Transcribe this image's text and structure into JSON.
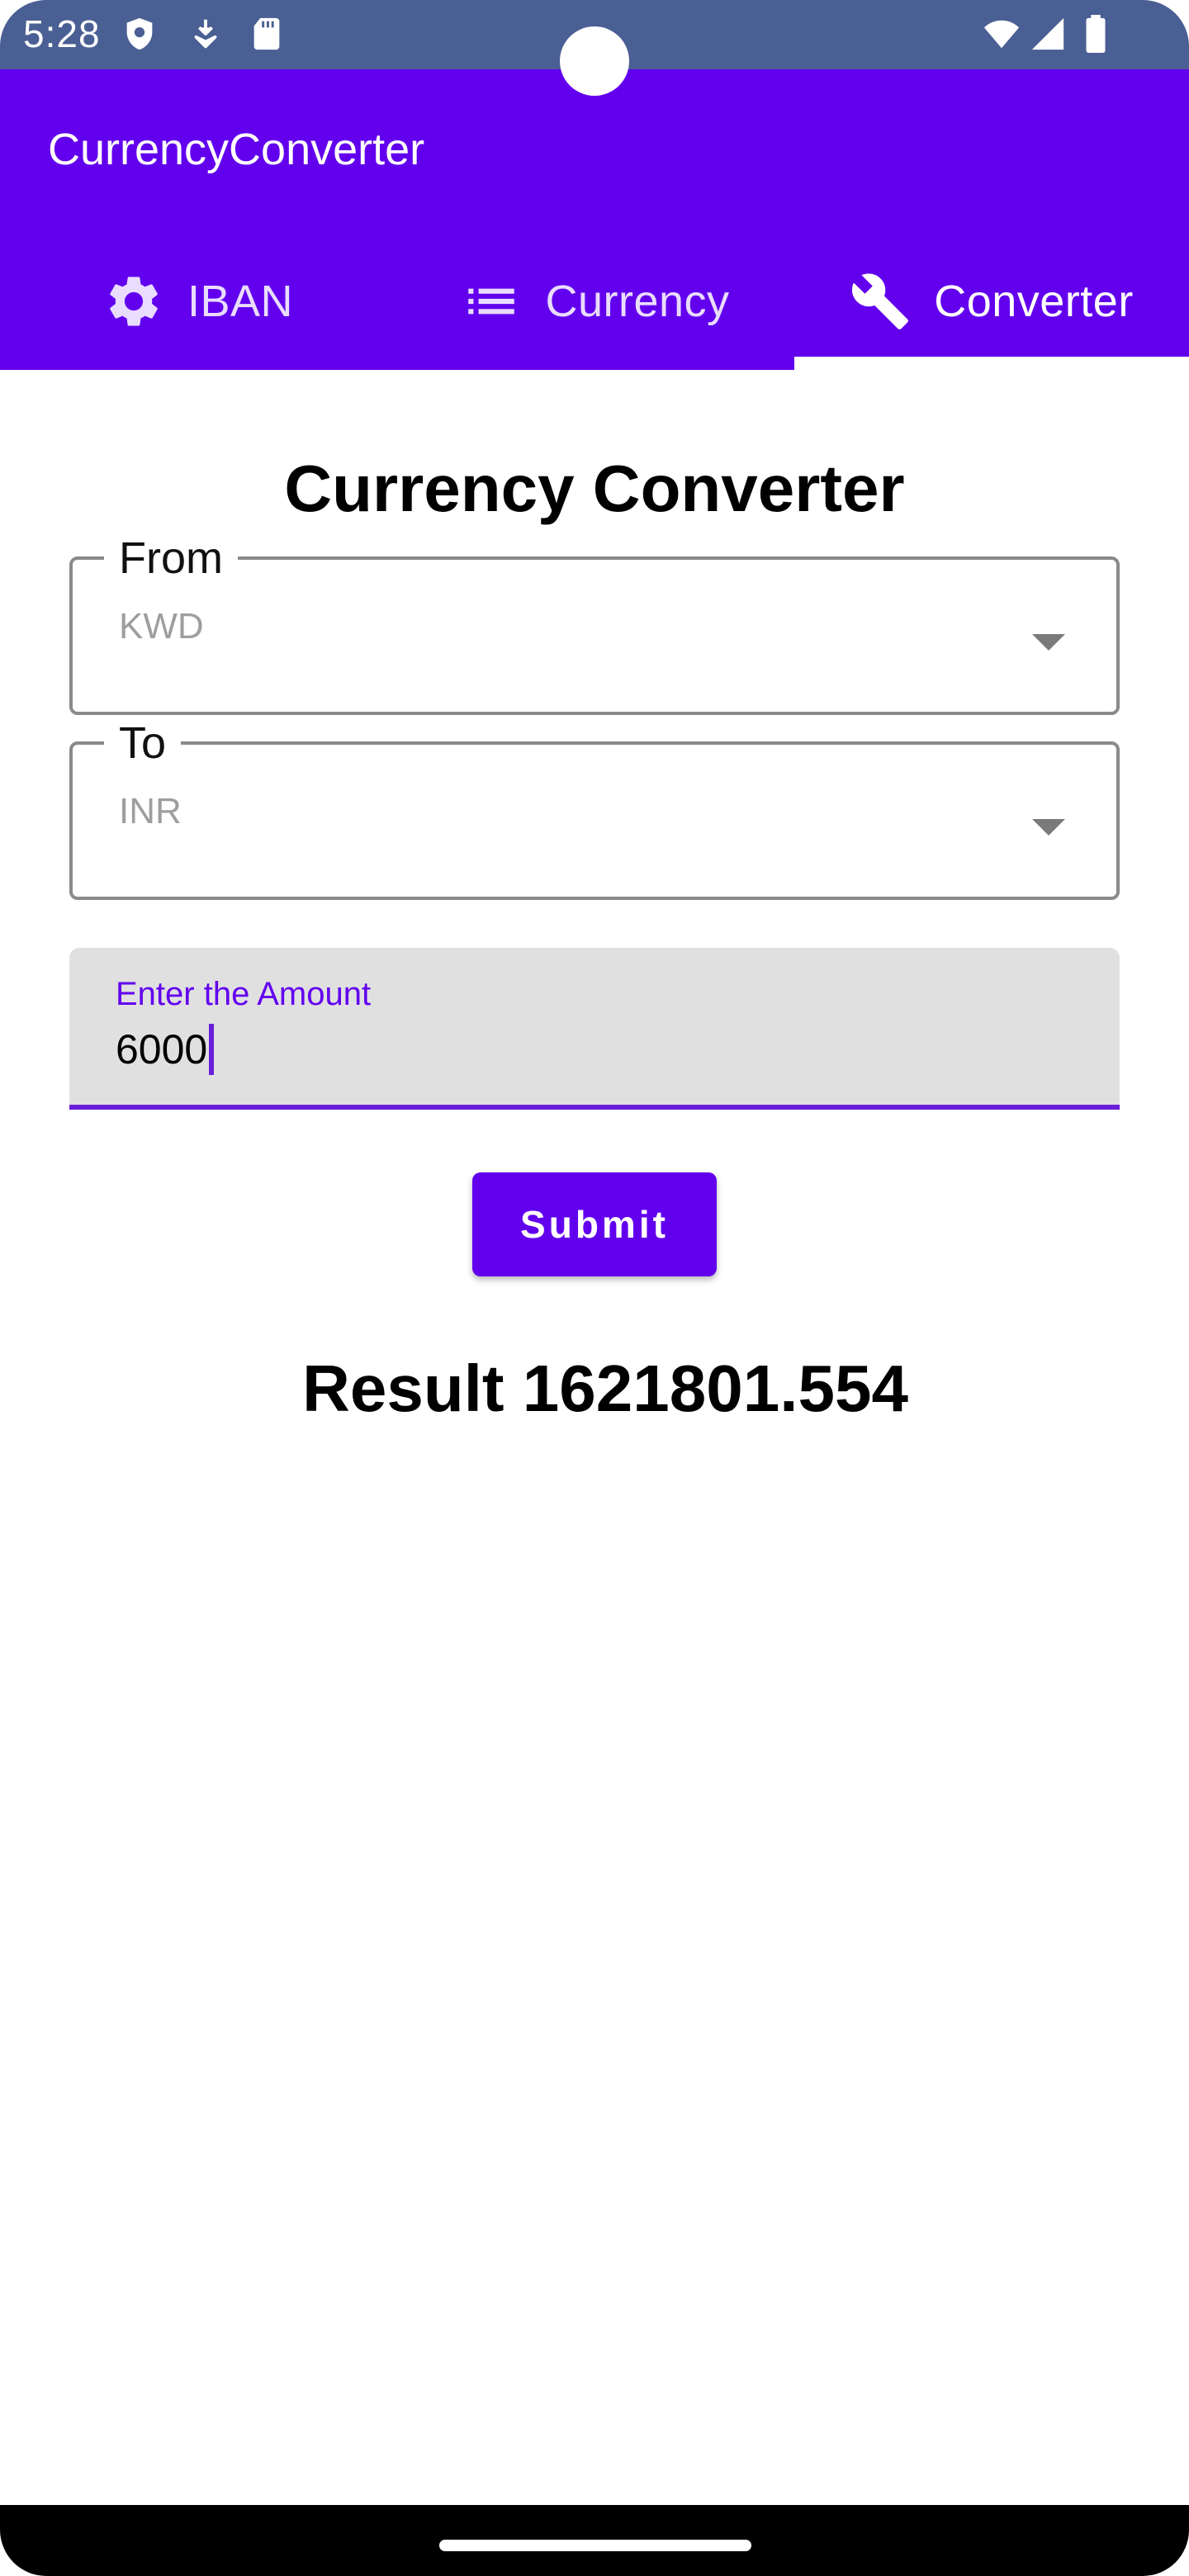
{
  "status_bar": {
    "time": "5:28",
    "left_icons": [
      "shield-icon",
      "download-icon",
      "sd-card-icon"
    ],
    "right_icons": [
      "wifi-icon",
      "signal-icon",
      "battery-icon"
    ]
  },
  "app_bar": {
    "title": "CurrencyConverter"
  },
  "tabs": [
    {
      "label": "IBAN",
      "icon": "gear-icon",
      "active": false
    },
    {
      "label": "Currency",
      "icon": "list-icon",
      "active": false
    },
    {
      "label": "Converter",
      "icon": "wrench-icon",
      "active": true
    }
  ],
  "main": {
    "title": "Currency Converter",
    "from": {
      "label": "From",
      "value": "KWD"
    },
    "to": {
      "label": "To",
      "value": "INR"
    },
    "amount": {
      "label": "Enter the Amount",
      "value": "6000"
    },
    "submit_label": "Submit",
    "result": "Result 1621801.554"
  },
  "colors": {
    "primary": "#6200ee",
    "status_bar": "#4a5f93",
    "text_field_bg": "#e0e0e0"
  }
}
